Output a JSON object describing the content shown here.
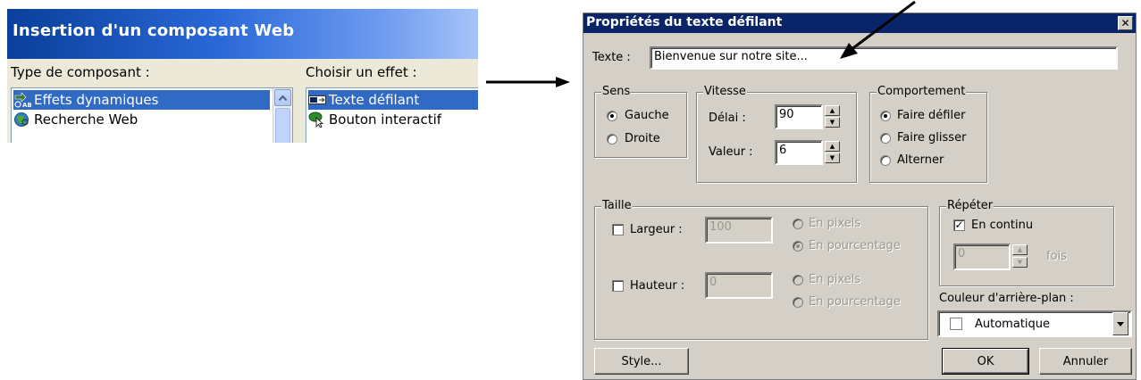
{
  "left_window": {
    "title": "Insertion d'un composant Web",
    "component_type_label": "Type de  composant :",
    "effect_label": "Choisir un effet :",
    "component_types": [
      "Effets dynamiques",
      "Recherche Web"
    ],
    "effects": [
      "Texte défilant",
      "Bouton interactif"
    ]
  },
  "dialog": {
    "title": "Propriétés du texte défilant",
    "close_glyph": "✕",
    "text_label": "Texte :",
    "text_value": "Bienvenue sur notre site...",
    "sens": {
      "legend": "Sens",
      "gauche": "Gauche",
      "droite": "Droite",
      "selected": "Gauche"
    },
    "vitesse": {
      "legend": "Vitesse",
      "delai_label": "Délai :",
      "delai_value": "90",
      "valeur_label": "Valeur :",
      "valeur_value": "6"
    },
    "comportement": {
      "legend": "Comportement",
      "defiler": "Faire défiler",
      "glisser": "Faire glisser",
      "alterner": "Alterner",
      "selected": "Faire défiler"
    },
    "taille": {
      "legend": "Taille",
      "largeur_label": "Largeur :",
      "largeur_value": "100",
      "hauteur_label": "Hauteur :",
      "hauteur_value": "0",
      "en_pixels": "En pixels",
      "en_pourcentage": "En pourcentage"
    },
    "repeter": {
      "legend": "Répéter",
      "continu_label": "En continu",
      "continu_checked": true,
      "count_value": "0",
      "fois": "fois"
    },
    "couleur": {
      "label": "Couleur d'arrière-plan :",
      "value": "Automatique"
    },
    "buttons": {
      "style": "Style...",
      "ok": "OK",
      "cancel": "Annuler"
    }
  },
  "colors": {
    "title_bar": "#0a246a",
    "selection": "#316ac5",
    "dialog_face": "#d4d0c8",
    "header_gradient_start": "#0a3f9a"
  }
}
